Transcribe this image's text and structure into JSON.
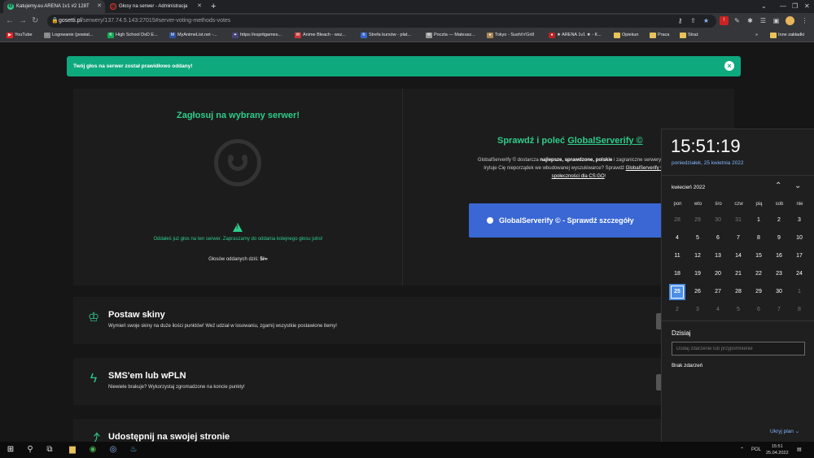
{
  "browser": {
    "tabs": [
      {
        "title": "Katujemy.eu ARENA 1v1 #2 128T",
        "active": true
      },
      {
        "title": "Głosy na serwer - Administracja",
        "active": false
      }
    ],
    "url_host": "gosetti.pl",
    "url_path": "/serwery/137.74.5.143:27015#server-voting-methods-votes",
    "bookmarks": [
      "YouTube",
      "Logowanie (powiat...",
      "High School DxD E...",
      "MyAnimeList.net -...",
      "https://espritgames...",
      "Anime Bleach - wsz...",
      "Strefa kursów - plat...",
      "Poczta — Mateusz...",
      "Tokyo - Sushi'n'Grill",
      "★ ARENA 1v1 ★ - K...",
      "Opiekun",
      "Praca",
      "Straż"
    ],
    "bookmarks_overflow": "»",
    "other_bookmarks": "Inne zakładki"
  },
  "alert": {
    "message": "Twój głos na serwer został prawidłowo oddany!",
    "close": "×"
  },
  "vote": {
    "title": "Zagłosuj na wybrany serwer!",
    "message": "Oddałeś już głos na ten serwer. Zapraszamy do oddania kolejnego głosu jutro!",
    "count_label": "Głosów oddanych dziś:",
    "count_value": "5/∞"
  },
  "globalserverify": {
    "title_prefix": "Sprawdź i poleć ",
    "title_link": "GlobalServerify ©",
    "desc_1": "GlobalServerify © dostarcza ",
    "desc_bold": "najlepsze, sprawdzone, polskie",
    "desc_2": " i zagraniczne serwery bezpośr",
    "desc_3": "Irytuje Cię nieporządek we wbudowanej wyszukiwarce? Sprawdź ",
    "desc_link": "GlobalServerify © - do",
    "desc_link2": "społeczności dla CS:GO",
    "desc_end": "!",
    "button": "GlobalServerify © - Sprawdź szczegóły"
  },
  "sections": [
    {
      "title": "Postaw skiny",
      "desc": "Wymień swoje skiny na duże ilości punktów! Weź udział w losowaniu, zgarnij wszystkie postawione itemy!",
      "icon": "trophy-icon"
    },
    {
      "title": "SMS'em lub wPLN",
      "desc": "Niewiele brakuje? Wykorzystaj zgromadzone na koncie punkty!",
      "icon": "lightning-icon"
    },
    {
      "title": "Udostępnij na swojej stronie",
      "desc": "",
      "icon": "share-icon"
    }
  ],
  "calendar": {
    "time": "15:51:19",
    "long_date": "poniedziałek, 25 kwietnia 2022",
    "month": "kwiecień 2022",
    "weekdays": [
      "pon",
      "wto",
      "śro",
      "czw",
      "pią",
      "sob",
      "nie"
    ],
    "weeks": [
      [
        28,
        29,
        30,
        31,
        1,
        2,
        3
      ],
      [
        4,
        5,
        6,
        7,
        8,
        9,
        10
      ],
      [
        11,
        12,
        13,
        14,
        15,
        16,
        17
      ],
      [
        18,
        19,
        20,
        21,
        22,
        23,
        24
      ],
      [
        25,
        26,
        27,
        28,
        29,
        30,
        1
      ],
      [
        2,
        3,
        4,
        5,
        6,
        7,
        8
      ]
    ],
    "today": 25,
    "today_label": "Dzisiaj",
    "event_placeholder": "Dodaj zdarzenie lub przypomnienie",
    "no_events": "Brak zdarzeń",
    "hide_plan": "Ukryj plan"
  },
  "taskbar": {
    "lang": "POL",
    "time": "15:51",
    "date": "25.04.2022"
  }
}
